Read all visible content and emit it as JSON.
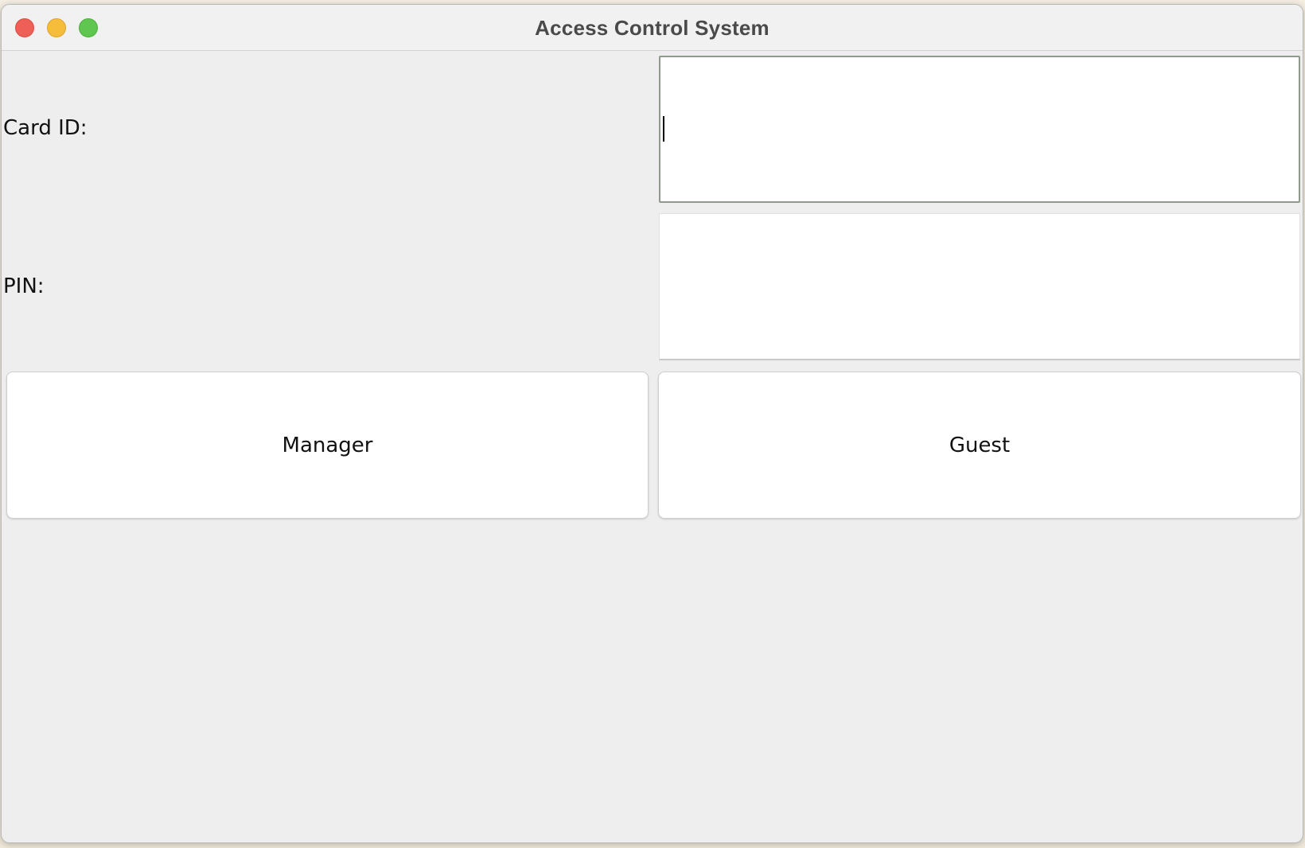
{
  "window": {
    "title": "Access Control System"
  },
  "form": {
    "card_id_label": "Card ID:",
    "card_id_value": "",
    "pin_label": "PIN:",
    "pin_value": ""
  },
  "buttons": {
    "manager_label": "Manager",
    "guest_label": "Guest"
  },
  "colors": {
    "close": "#ee5f57",
    "minimize": "#f6bd3b",
    "zoom": "#5fc64f",
    "window_bg": "#eeeeee"
  }
}
